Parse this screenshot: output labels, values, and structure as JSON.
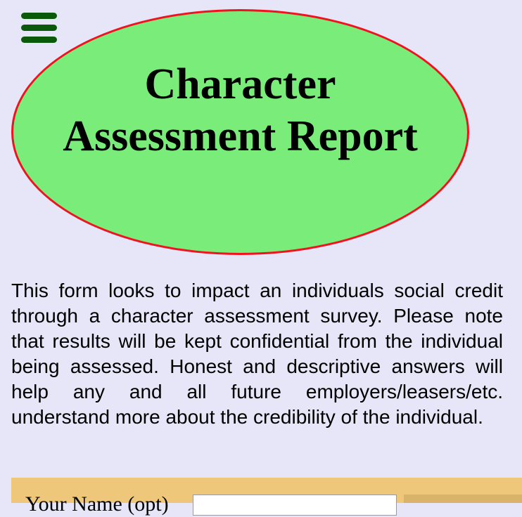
{
  "header": {
    "menu_icon": "hamburger-menu-icon",
    "title_line1": "Character",
    "title_line2": "Assessment Report"
  },
  "intro": {
    "text": "This form looks to impact an individuals social credit through a character assessment survey. Please note that results will be kept confidential from the individual being assessed. Honest and descriptive answers will help any and all future employers/leasers/etc. understand more about the credibility of the individual."
  },
  "form": {
    "name_label": "Your Name (opt)",
    "name_value": ""
  },
  "colors": {
    "page_background": "#e6e6f8",
    "menu_icon": "#0b5a0b",
    "ellipse_fill": "#7aec7a",
    "ellipse_border": "#f0131f",
    "form_band": "#efc77b"
  }
}
